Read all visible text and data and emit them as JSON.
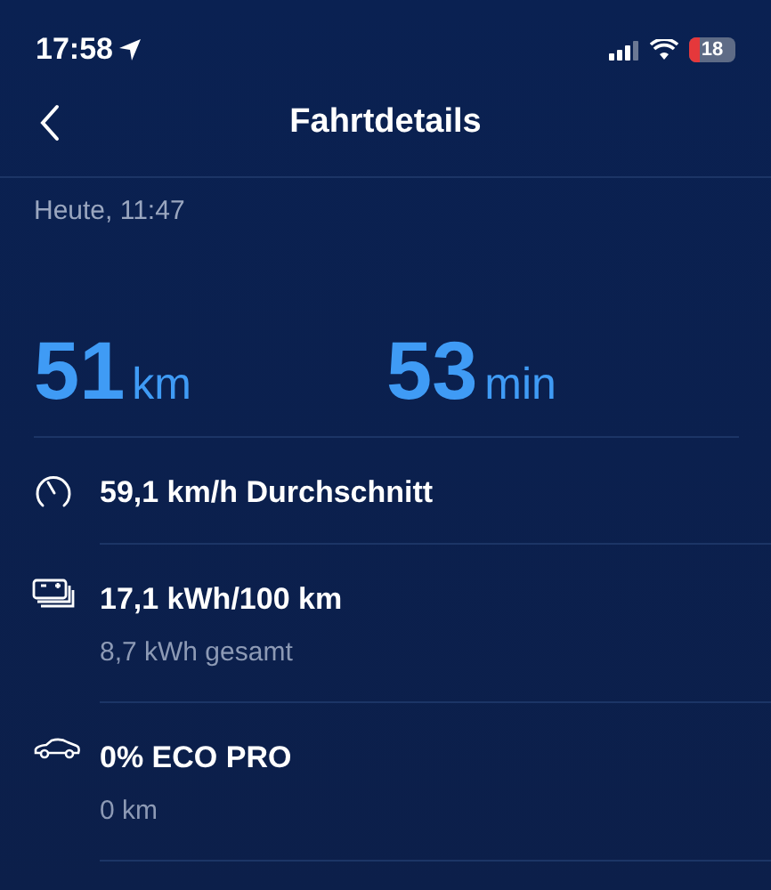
{
  "status_bar": {
    "time": "17:58",
    "battery": "18"
  },
  "header": {
    "title": "Fahrtdetails"
  },
  "date": "Heute, 11:47",
  "stats": [
    {
      "value": "51",
      "unit": "km"
    },
    {
      "value": "53",
      "unit": "min"
    }
  ],
  "details": [
    {
      "kind": "speed",
      "title": "59,1 km/h Durchschnitt"
    },
    {
      "kind": "energy",
      "title": "17,1 kWh/100 km",
      "subtitle": "8,7 kWh gesamt"
    },
    {
      "kind": "eco",
      "title": "0% ECO PRO",
      "subtitle": "0 km"
    }
  ]
}
